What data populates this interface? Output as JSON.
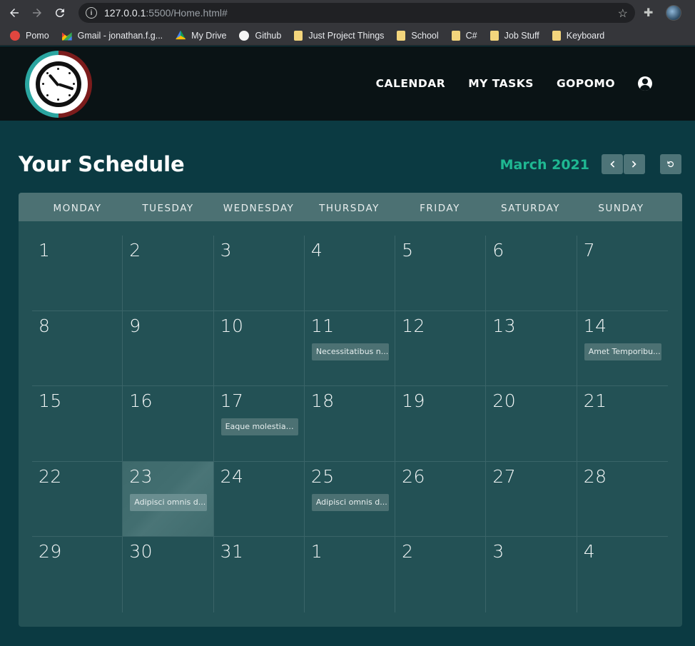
{
  "browser": {
    "url_host": "127.0.0.1",
    "url_rest": ":5500/Home.html#"
  },
  "bookmarks": [
    {
      "label": "Pomo",
      "icon": "pomo"
    },
    {
      "label": "Gmail - jonathan.f.g...",
      "icon": "gmail"
    },
    {
      "label": "My Drive",
      "icon": "drive"
    },
    {
      "label": "Github",
      "icon": "github"
    },
    {
      "label": "Just Project Things",
      "icon": "folder"
    },
    {
      "label": "School",
      "icon": "folder"
    },
    {
      "label": "C#",
      "icon": "folder"
    },
    {
      "label": "Job Stuff",
      "icon": "folder"
    },
    {
      "label": "Keyboard",
      "icon": "folder"
    }
  ],
  "nav": {
    "calendar": "CALENDAR",
    "tasks": "MY TASKS",
    "gopomo": "GOPOMO"
  },
  "schedule": {
    "title": "Your Schedule",
    "month": "March 2021"
  },
  "colors": {
    "accent": "#1fb892",
    "page_bg": "#0b3a42",
    "calendar_bg": "#235155",
    "header_bg": "#0a1315"
  },
  "calendar": {
    "day_names": [
      "MONDAY",
      "TUESDAY",
      "WEDNESDAY",
      "THURSDAY",
      "FRIDAY",
      "SATURDAY",
      "SUNDAY"
    ],
    "weeks": [
      [
        {
          "d": "1"
        },
        {
          "d": "2"
        },
        {
          "d": "3"
        },
        {
          "d": "4"
        },
        {
          "d": "5"
        },
        {
          "d": "6"
        },
        {
          "d": "7"
        }
      ],
      [
        {
          "d": "8"
        },
        {
          "d": "9"
        },
        {
          "d": "10"
        },
        {
          "d": "11",
          "event": "Necessitatibus n..."
        },
        {
          "d": "12"
        },
        {
          "d": "13"
        },
        {
          "d": "14",
          "event": "Amet Temporibu..."
        }
      ],
      [
        {
          "d": "15"
        },
        {
          "d": "16"
        },
        {
          "d": "17",
          "event": "Eaque molestiae ..."
        },
        {
          "d": "18"
        },
        {
          "d": "19"
        },
        {
          "d": "20"
        },
        {
          "d": "21"
        }
      ],
      [
        {
          "d": "22"
        },
        {
          "d": "23",
          "event": "Adipisci omnis d...",
          "today": true
        },
        {
          "d": "24"
        },
        {
          "d": "25",
          "event": "Adipisci omnis d..."
        },
        {
          "d": "26"
        },
        {
          "d": "27"
        },
        {
          "d": "28"
        }
      ],
      [
        {
          "d": "29"
        },
        {
          "d": "30"
        },
        {
          "d": "31"
        },
        {
          "d": "1"
        },
        {
          "d": "2"
        },
        {
          "d": "3"
        },
        {
          "d": "4"
        }
      ]
    ]
  }
}
